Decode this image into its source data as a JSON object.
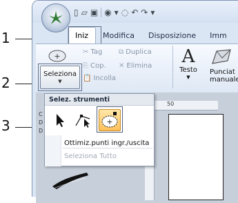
{
  "callouts": [
    "1",
    "2",
    "3"
  ],
  "tabs": [
    {
      "label": "Iniz",
      "active": true
    },
    {
      "label": "Modifica",
      "active": false
    },
    {
      "label": "Disposizione",
      "active": false
    },
    {
      "label": "Imm",
      "active": false
    }
  ],
  "clipboard_group": {
    "items": [
      "Tag",
      "Duplica",
      "Cop.",
      "Elimina",
      "Incolla"
    ]
  },
  "seleziona_button": {
    "label": "Seleziona"
  },
  "text_button": {
    "label": "Testo"
  },
  "punch_button": {
    "label": "Punciat\nmanuale"
  },
  "ruler": {
    "mark": "50"
  },
  "menu": {
    "header": "Selez. strumenti",
    "items": [
      {
        "label": "Ottimiz.punti ingr./uscita",
        "enabled": true
      },
      {
        "label": "Seleziona Tutto",
        "enabled": false
      }
    ]
  },
  "doc_strip_letters": [
    "C",
    "D",
    "D"
  ],
  "colors": {
    "accent": "#ffc15a",
    "frame": "#7f93b3"
  }
}
